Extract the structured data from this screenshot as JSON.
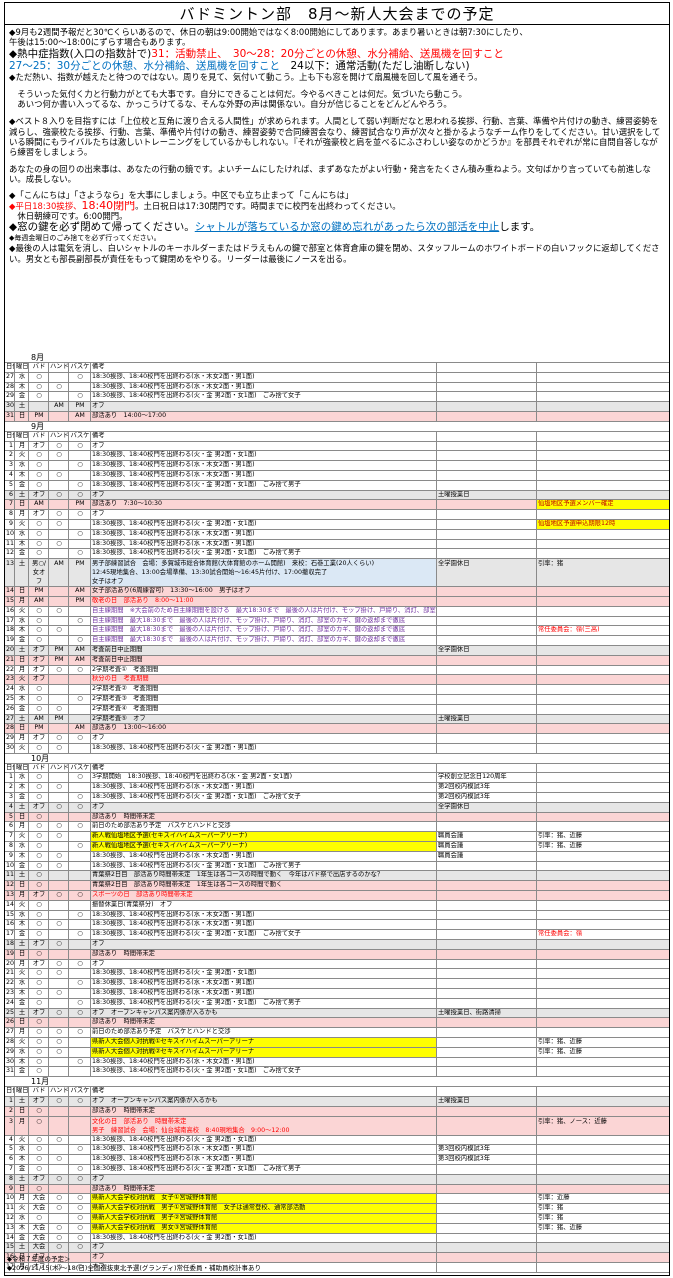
{
  "title": "バドミントン部　8月～新人大会までの予定",
  "notes": {
    "l1": "◆9月も2週間予報だと30℃くらいあるので、休日の朝は9:00開始ではなく8:00開始にしてあります。あまり暑いときは朝7:30にしたり、",
    "l2": "午後は15:00～18:00にずらす場合もあります。",
    "l3a": "◆熱中症指数(入口の指数計で)",
    "l3b": "31：活動禁止、",
    "l3c": "30～28：20分ごとの休憩、水分補給、送風機を回すこと",
    "l4a": "27～25：30分ごとの休憩、水分補給、送風機を回すこと",
    "l4b": "　24以下：通常活動(ただし油断しない)",
    "l5": "◆ただ熱い、指数が越えたと待つのではない。周りを見て、気付いて動こう。上も下も窓を開けて扇風機を回して風を通そう。",
    "l6": "　そういった気付く力と行動力がとても大事です。自分にできることは何だ。今やるべきことは何だ。気づいたら動こう。",
    "l7": "　あいつ何か書い入ってるな、かっこうけてるな、そんな外野の声は関係ない。自分が信じることをどんどんやろう。",
    "l8": "◆ベスト８入りを目指すには「上位校と互角に渡り合える人間性」が求められます。人間として弱い判断だなと思われる挨拶、行動、言葉、準備や片付けの動き、練習姿勢を減らし、強豪校たる挨拶、行動、言葉、準備や片付けの動き、練習姿勢で合同練習会なり、練習試合なり声が次々と掛かるようなチーム作りをしてください。甘い選択をしている瞬間にもライバルたちは激しいトレーニングをしているかもしれない。『それが強豪校と肩を並べるにふさわしい姿なのかどうか』を部員それぞれが常に自問自答しながら練習をしましょう。",
    "l9": "あなたの身の回りの出来事は、あなたの行動の鏡です。よいチームにしたければ、まずあなたがよい行動・発言をたくさん積み重ねよう。文句ばかり言っていても前進しない。成長しない。",
    "l10": "◆「こんにちは」「さようなら」を大事にしましょう。中区でも立ち止まって「こんにちは」",
    "l11a": "◆平日18:30挨拶、",
    "l11b": "18:40閉門",
    "l11c": "。土日祝日は17:30閉門です。時間までに校門を出終わってください。",
    "l12": "　休日朝練可です。6:00開門。",
    "l13a": "◆窓の鍵を必ず閉めて帰ってください。",
    "l13b": "シャトルが落ちているか窓の鍵め忘れがあったら次の部活を中止",
    "l13c": "します。",
    "l14": "◆毎週金曜日のごみ捨てを必ず行ってください。",
    "l15": "◆最後の人は電気を消し、白いシャトルのキーホルダーまたはドラえもんの鍵で部室と体育倉庫の鍵を閉め、スタッフルームのホワイトボードの白いフックに返却してください。男女とも部長副部長が責任をもって鍵閉めをやりる。リーダーは最後にノースを出る。"
  },
  "header": [
    "日付",
    "曜日",
    "バド",
    "ハンド",
    "バスケ",
    "備考"
  ],
  "months": [
    "8月",
    "9月",
    "10月",
    "11月"
  ],
  "colors": {
    "sun": "#fbd5d5",
    "sat": "#e6e6e6",
    "highlight": "#ffff00",
    "blue": "#dbe8f5"
  },
  "aug": [
    [
      "27",
      "水",
      "○",
      "",
      "○",
      "18:30挨拶、18:40校門を出終わる(水・木女2面・男1面)",
      "",
      ""
    ],
    [
      "28",
      "木",
      "○",
      "○",
      "",
      "18:30挨拶、18:40校門を出終わる(水・木女2面・男1面)",
      "",
      ""
    ],
    [
      "29",
      "金",
      "○",
      "",
      "○",
      "18:30挨拶、18:40校門を出終わる(火・金 男2面・女1面)　ごみ捨て女子",
      "",
      ""
    ],
    [
      "30",
      "土",
      "",
      "AM",
      "PM",
      "オフ",
      "",
      ""
    ],
    [
      "31",
      "日",
      "PM",
      "",
      "AM",
      "部活あり　14:00～17:00",
      "",
      ""
    ]
  ],
  "sep": [
    [
      "1",
      "月",
      "オフ",
      "○",
      "○",
      "オフ",
      "",
      ""
    ],
    [
      "2",
      "火",
      "○",
      "○",
      "",
      "18:30挨拶、18:40校門を出終わる(火・金 男2面・女1面)",
      "",
      ""
    ],
    [
      "3",
      "水",
      "○",
      "",
      "○",
      "18:30挨拶、18:40校門を出終わる(水・木女2面・男1面)",
      "",
      ""
    ],
    [
      "4",
      "木",
      "○",
      "○",
      "",
      "18:30挨拶、18:40校門を出終わる(水・木女2面・男1面)",
      "",
      ""
    ],
    [
      "5",
      "金",
      "○",
      "",
      "○",
      "18:30挨拶、18:40校門を出終わる(火・金 男2面・女1面)　ごみ捨て男子",
      "",
      ""
    ],
    [
      "6",
      "土",
      "オフ",
      "○",
      "○",
      "オフ",
      "土曜授業日",
      ""
    ],
    [
      "7",
      "日",
      "AM",
      "",
      "PM",
      "部活あり　7:30～10:30",
      "",
      "仙塩地区予選メンバー確定"
    ],
    [
      "8",
      "月",
      "オフ",
      "○",
      "○",
      "オフ",
      "",
      ""
    ],
    [
      "9",
      "火",
      "○",
      "○",
      "",
      "18:30挨拶、18:40校門を出終わる(火・金 男2面・女1面)",
      "",
      "仙塩地区予選申込期限12時"
    ],
    [
      "10",
      "水",
      "○",
      "",
      "○",
      "18:30挨拶、18:40校門を出終わる(水・木女2面・男1面)",
      "",
      ""
    ],
    [
      "11",
      "木",
      "○",
      "○",
      "",
      "18:30挨拶、18:40校門を出終わる(水・木女2面・男1面)",
      "",
      ""
    ],
    [
      "12",
      "金",
      "○",
      "",
      "○",
      "18:30挨拶、18:40校門を出終わる(火・金 男2面・女1面)　ごみ捨て男子",
      "",
      ""
    ]
  ],
  "sep13": {
    "d": "13",
    "w": "土",
    "b": "男○/女オフ",
    "h": "AM",
    "k": "PM",
    "t1": "男子部練習試合　会場：多賀城市総合体育館(大体育館のホーム開館)　来校：石巻工業(20人くらい)",
    "t2": "12:45現地集合、13:00会場準備、13:30試合開始～16:45片付け、17:00撤収完了",
    "t3": "女子はオフ",
    "f": "全学園休日",
    "g": "引率：猪"
  },
  "sep2": [
    [
      "14",
      "日",
      "PM",
      "",
      "AM",
      "女子部活あり(6周練習可)　13:30～16:00　男子はオフ",
      "",
      ""
    ],
    [
      "15",
      "月",
      "AM",
      "",
      "PM",
      "敬老の日　部活あり　8:00～11:00",
      "",
      ""
    ],
    [
      "16",
      "火",
      "○",
      "○",
      "",
      "自主練期間　※大会前のため自主練期間を設ける　最大18:30まで　最後の人は片付け、モップ掛け、戸締り、消灯、部室のカギ、鍵の返却まで徹底",
      "",
      ""
    ],
    [
      "17",
      "水",
      "○",
      "",
      "○",
      "自主練期間　最大18:30まで　最後の人は片付け、モップ掛け、戸締り、消灯、部室のカギ、鍵の返却まで徹底",
      "",
      ""
    ],
    [
      "18",
      "木",
      "○",
      "○",
      "",
      "自主練期間　最大18:30まで　最後の人は片付け、モップ掛け、戸締り、消灯、部室のカギ、鍵の返却まで徹底",
      "",
      "常任委員会：嶺(三高)"
    ],
    [
      "19",
      "金",
      "○",
      "",
      "○",
      "自主練期間　最大18:30まで　最後の人は片付け、モップ掛け、戸締り、消灯、部室のカギ、鍵の返却まで徹底",
      "",
      ""
    ],
    [
      "20",
      "土",
      "オフ",
      "PM",
      "AM",
      "考査前日中止期間",
      "全学園休日",
      ""
    ],
    [
      "21",
      "日",
      "オフ",
      "PM",
      "AM",
      "考査前日中止期間",
      "",
      ""
    ],
    [
      "22",
      "月",
      "オフ",
      "○",
      "○",
      "2学期考査①　考査期間",
      "",
      ""
    ],
    [
      "23",
      "火",
      "オフ",
      "",
      "",
      "秋分の日　考査期間",
      "",
      ""
    ],
    [
      "24",
      "水",
      "○",
      "",
      "",
      "2学期考査②　考査期間",
      "",
      ""
    ],
    [
      "25",
      "木",
      "○",
      "",
      "○",
      "2学期考査③　考査期間",
      "",
      ""
    ],
    [
      "26",
      "金",
      "○",
      "○",
      "",
      "2学期考査④　考査期間",
      "",
      ""
    ],
    [
      "27",
      "土",
      "AM",
      "PM",
      "",
      "2学期考査⑤　オフ",
      "土曜授業日",
      ""
    ],
    [
      "28",
      "日",
      "PM",
      "",
      "AM",
      "部活あり　13:00～16:00",
      "",
      ""
    ],
    [
      "29",
      "月",
      "オフ",
      "○",
      "○",
      "オフ",
      "",
      ""
    ],
    [
      "30",
      "火",
      "○",
      "○",
      "",
      "18:30挨拶、18:40校門を出終わる(火・金 男2面・男1面)",
      "",
      ""
    ]
  ],
  "oct": [
    [
      "1",
      "水",
      "○",
      "",
      "○",
      "3学期開始　18:30挨拶、18:40校門を出終わる(水・金 男2面・女1面)",
      "学校創立記念日120周年",
      ""
    ],
    [
      "2",
      "木",
      "○",
      "○",
      "",
      "18:30挨拶、18:40校門を出終わる(水・木女2面・男1面)",
      "第2回校内模試3年",
      ""
    ],
    [
      "3",
      "金",
      "○",
      "",
      "○",
      "18:30挨拶、18:40校門を出終わる(火・金 男2面・女1面)　ごみ捨て女子",
      "第2回校内模試3年",
      ""
    ],
    [
      "4",
      "土",
      "オフ",
      "○",
      "○",
      "オフ",
      "全学園休日",
      ""
    ],
    [
      "5",
      "日",
      "○",
      "",
      "",
      "部活あり　時間帯未定",
      "",
      ""
    ],
    [
      "6",
      "月",
      "○",
      "○",
      "○",
      "前日のため部活あり予定　バスケとハンドと交渉",
      "",
      ""
    ],
    [
      "7",
      "火",
      "○",
      "○",
      "",
      "新人戦仙塩地区予選(セキスイハイムスーパーアリーナ)",
      "職員会議",
      "引率：猪、近藤"
    ],
    [
      "8",
      "水",
      "○",
      "",
      "○",
      "新人戦仙塩地区予選(セキスイハイムスーパーアリーナ)",
      "職員会議",
      "引率：猪、近藤"
    ],
    [
      "9",
      "木",
      "○",
      "○",
      "",
      "18:30挨拶、18:40校門を出終わる(水・木女2面・男1面)",
      "職員会議",
      ""
    ],
    [
      "10",
      "金",
      "○",
      "○",
      "",
      "18:30挨拶、18:40校門を出終わる(火・金 男2面・女1面)　ごみ捨て男子",
      "",
      ""
    ],
    [
      "11",
      "土",
      "○",
      "",
      "",
      "青葉祭2日目　部活あり時間帯未定　1年生は各コースの時間で動く　今年はバド祭で出店するのかな？",
      "",
      ""
    ],
    [
      "12",
      "日",
      "○",
      "",
      "",
      "青葉祭2日目　部活あり時間帯未定　1年生は各コースの時間で動く",
      "",
      ""
    ],
    [
      "13",
      "月",
      "オフ",
      "○",
      "○",
      "スポーツの日　部活あり時間帯未定",
      "",
      ""
    ],
    [
      "14",
      "火",
      "○",
      "",
      "",
      "振替休業日(青葉祭分)　オフ",
      "",
      ""
    ],
    [
      "15",
      "水",
      "○",
      "",
      "○",
      "18:30挨拶、18:40校門を出終わる(水・木女2面・男1面)",
      "",
      ""
    ],
    [
      "16",
      "木",
      "○",
      "○",
      "",
      "18:30挨拶、18:40校門を出終わる(水・木女2面・男1面)",
      "",
      ""
    ],
    [
      "17",
      "金",
      "○",
      "",
      "○",
      "18:30挨拶、18:40校門を出終わる(火・金 男2面・女1面)　ごみ捨て女子",
      "",
      "常任委員会：嶺"
    ],
    [
      "18",
      "土",
      "オフ",
      "○",
      "",
      "オフ",
      "",
      ""
    ],
    [
      "19",
      "日",
      "○",
      "",
      "",
      "部活あり　時間帯未定",
      "",
      ""
    ],
    [
      "20",
      "月",
      "オフ",
      "○",
      "○",
      "オフ",
      "",
      ""
    ],
    [
      "21",
      "火",
      "○",
      "○",
      "",
      "18:30挨拶、18:40校門を出終わる(火・金 男2面・女1面)",
      "",
      ""
    ],
    [
      "22",
      "水",
      "○",
      "",
      "○",
      "18:30挨拶、18:40校門を出終わる(水・木女2面・男1面)",
      "",
      ""
    ],
    [
      "23",
      "木",
      "○",
      "○",
      "",
      "18:30挨拶、18:40校門を出終わる(水・木女2面・男1面)",
      "",
      ""
    ],
    [
      "24",
      "金",
      "○",
      "",
      "○",
      "18:30挨拶、18:40校門を出終わる(火・金 男2面・女1面)　ごみ捨て男子",
      "",
      ""
    ],
    [
      "25",
      "土",
      "オフ",
      "○",
      "○",
      "オフ　オープンキャンパス案内係が入るかも",
      "土曜授業日、街路清掃",
      ""
    ],
    [
      "26",
      "日",
      "○",
      "",
      "",
      "部活あり　時間帯未定",
      "",
      ""
    ],
    [
      "27",
      "月",
      "○",
      "○",
      "○",
      "前日のため部活あり予定　バスケとハンドと交渉",
      "",
      ""
    ],
    [
      "28",
      "火",
      "○",
      "○",
      "",
      "県新人大会個人対抗戦①セキスイハイムスーパーアリーナ",
      "",
      "引率：猪、近藤"
    ],
    [
      "29",
      "水",
      "○",
      "○",
      "",
      "県新人大会個人対抗戦②セキスイハイムスーパーアリーナ",
      "",
      "引率：猪、近藤"
    ],
    [
      "30",
      "木",
      "○",
      "",
      "○",
      "18:30挨拶、18:40校門を出終わる(水・木女2面・男1面)",
      "",
      ""
    ],
    [
      "31",
      "金",
      "○",
      "",
      "",
      "18:30挨拶、18:40校門を出終わる(火・金 男2面・女1面)　ごみ捨て女子",
      "",
      ""
    ]
  ],
  "nov": [
    [
      "1",
      "土",
      "オフ",
      "○",
      "○",
      "オフ　オープンキャンパス案内係が入るかも",
      "土曜授業日",
      ""
    ],
    [
      "2",
      "日",
      "○",
      "",
      "",
      "部活あり　時間帯未定",
      "",
      ""
    ],
    [
      "3",
      "月",
      "○",
      "",
      "",
      "文化の日　部活あり　時間帯未定|男子　練習試合　会場：仙台城南高校　8:40現地集合　9:00～12:00",
      "",
      "引率：猪、ノース：近藤"
    ],
    [
      "4",
      "火",
      "○",
      "○",
      "",
      "18:30挨拶、18:40校門を出終わる(火・金 男2面・女1面)",
      "",
      ""
    ],
    [
      "5",
      "水",
      "○",
      "",
      "○",
      "18:30挨拶、18:40校門を出終わる(水・木女2面・男1面)",
      "第3回校内模試3年",
      ""
    ],
    [
      "6",
      "木",
      "○",
      "○",
      "",
      "18:30挨拶、18:40校門を出終わる(水・木女2面・男1面)",
      "第3回校内模試3年",
      ""
    ],
    [
      "7",
      "金",
      "○",
      "",
      "○",
      "18:30挨拶、18:40校門を出終わる(火・金 男2面・女1面)　ごみ捨て男子",
      "",
      ""
    ],
    [
      "8",
      "土",
      "オフ",
      "○",
      "○",
      "オフ",
      "",
      ""
    ],
    [
      "9",
      "日",
      "○",
      "",
      "",
      "部活あり　時間帯未定",
      "",
      ""
    ],
    [
      "10",
      "月",
      "大会",
      "○",
      "○",
      "県新人大会学校対抗戦　女子①宮城野体育館",
      "",
      "引率：近藤"
    ],
    [
      "11",
      "火",
      "大会",
      "○",
      "○",
      "県新人大会学校対抗戦　男子①宮城野体育館　女子は通常登校、通常部活動",
      "",
      "引率：猪"
    ],
    [
      "12",
      "水",
      "○",
      "",
      "○",
      "県新人大会学校対抗戦　男子②宮城野体育館",
      "",
      "引率：猪"
    ],
    [
      "13",
      "木",
      "大会",
      "○",
      "○",
      "県新人大会学校対抗戦　男女③宮城野体育館",
      "",
      "引率：猪、近藤"
    ],
    [
      "14",
      "金",
      "大会",
      "○",
      "○",
      "18:30挨拶、18:40校門を出終わる(火・金 男2面・女1面)",
      "",
      ""
    ],
    [
      "15",
      "土",
      "大会",
      "○",
      "○",
      "オフ",
      "",
      ""
    ],
    [
      "16",
      "日",
      "オフ",
      "",
      "",
      "オフ",
      "",
      ""
    ],
    [
      "17",
      "月",
      "オフ",
      "○",
      "○",
      "オフ",
      "",
      ""
    ]
  ],
  "footer": {
    "f1": "◆令和７年度の予定＞",
    "f2": "◆2026/11/15(木)～18(日)全国選抜東北予選(グランディ)常任委員・補助員校計事あり"
  }
}
